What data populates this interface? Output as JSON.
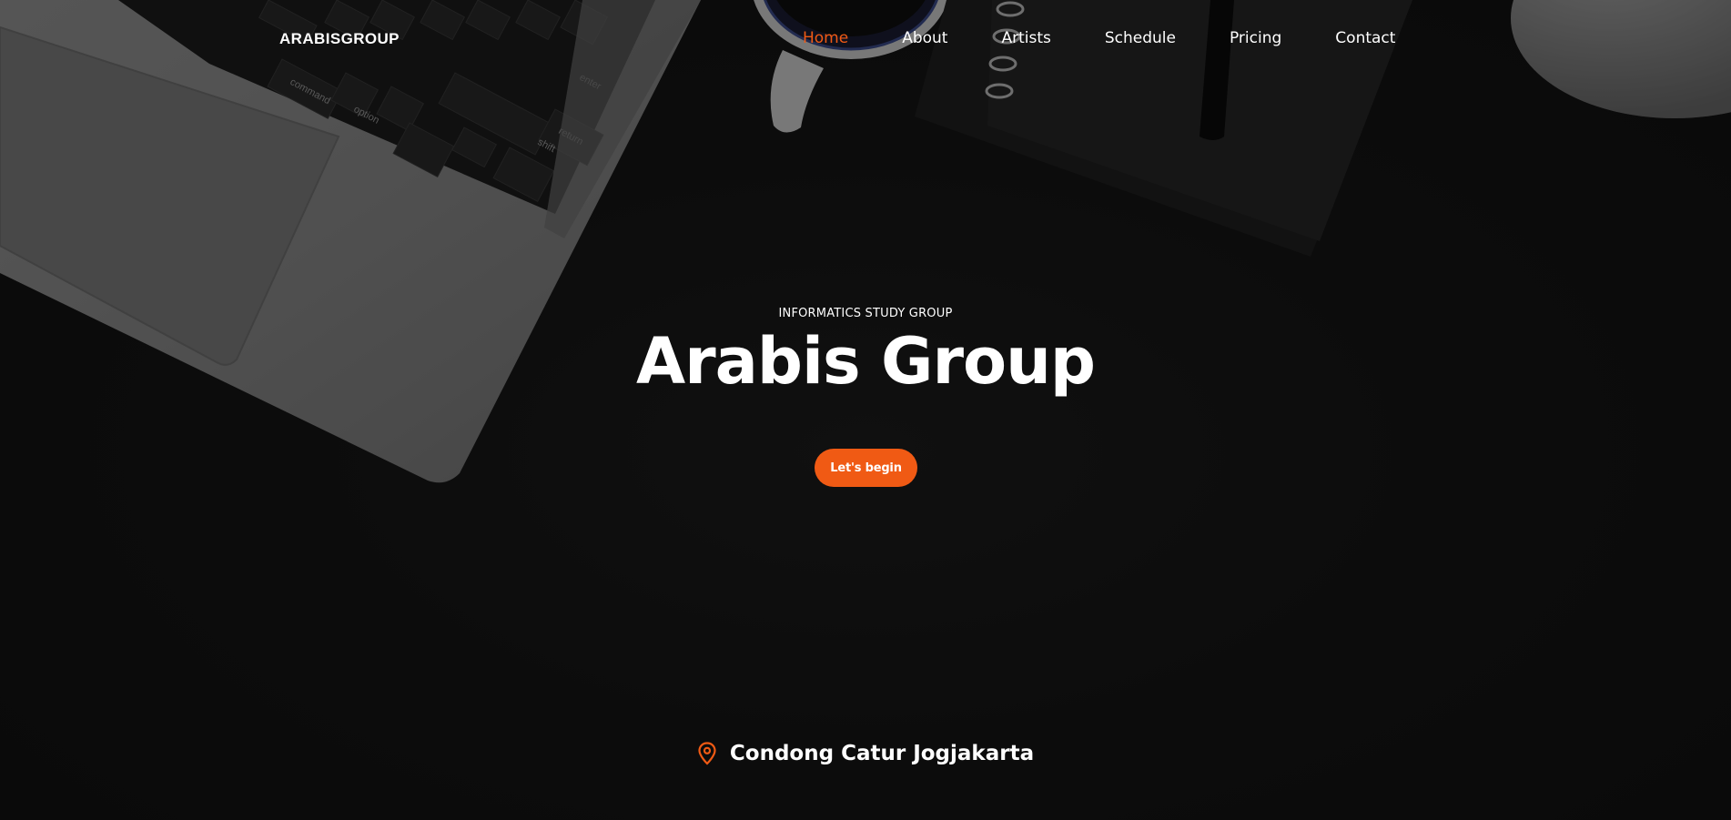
{
  "brand": {
    "name": "ARABISGROUP"
  },
  "nav": {
    "items": [
      {
        "label": "Home",
        "active": true
      },
      {
        "label": "About",
        "active": false
      },
      {
        "label": "Artists",
        "active": false
      },
      {
        "label": "Schedule",
        "active": false
      },
      {
        "label": "Pricing",
        "active": false
      },
      {
        "label": "Contact",
        "active": false
      }
    ]
  },
  "hero": {
    "kicker": "INFORMATICS STUDY GROUP",
    "title": "Arabis Group",
    "cta_label": "Let's begin"
  },
  "location": {
    "icon": "map-pin-icon",
    "text": "Condong Catur Jogjakarta"
  },
  "colors": {
    "accent": "#f05a14",
    "background": "#141414",
    "text": "#ffffff"
  }
}
